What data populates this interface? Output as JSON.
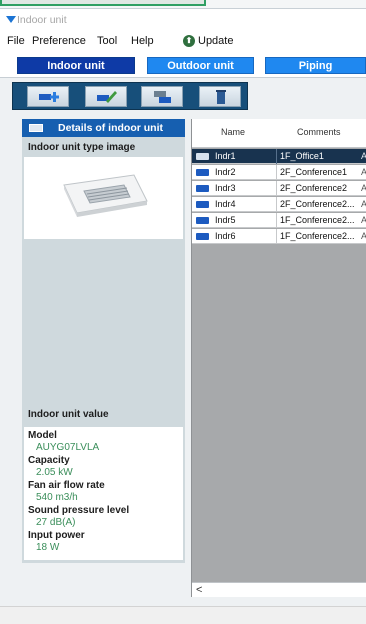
{
  "window": {
    "title": "Indoor unit"
  },
  "menu": {
    "file": "File",
    "preference": "Preference",
    "tool": "Tool",
    "help": "Help",
    "update": "Update"
  },
  "tabs": [
    {
      "label": "Indoor unit",
      "active": true
    },
    {
      "label": "Outdoor unit",
      "active": false
    },
    {
      "label": "Piping",
      "active": false
    }
  ],
  "toolbar": {
    "buttons": [
      "add-unit-icon",
      "edit-unit-icon",
      "copy-unit-icon",
      "delete-icon"
    ]
  },
  "details": {
    "header": "Details of indoor unit",
    "type_image_label": "Indoor unit type image",
    "value_label": "Indoor unit value",
    "fields": [
      {
        "label": "Model",
        "value": "AUYG07LVLA"
      },
      {
        "label": "Capacity",
        "value": "2.05 kW"
      },
      {
        "label": "Fan air flow rate",
        "value": "540 m3/h"
      },
      {
        "label": "Sound pressure level",
        "value": "27 dB(A)"
      },
      {
        "label": "Input power",
        "value": "18 W"
      }
    ]
  },
  "table": {
    "columns": [
      "Name",
      "Comments"
    ],
    "rows": [
      {
        "name": "Indr1",
        "comments": "1F_Office1",
        "trail": "A",
        "selected": true
      },
      {
        "name": "Indr2",
        "comments": "2F_Conference1",
        "trail": "A",
        "selected": false
      },
      {
        "name": "Indr3",
        "comments": "2F_Conference2",
        "trail": "A",
        "selected": false
      },
      {
        "name": "Indr4",
        "comments": "2F_Conference2...",
        "trail": "A",
        "selected": false
      },
      {
        "name": "Indr5",
        "comments": "1F_Conference2...",
        "trail": "A",
        "selected": false
      },
      {
        "name": "Indr6",
        "comments": "1F_Conference2...",
        "trail": "A",
        "selected": false
      }
    ],
    "scroll_left": "<"
  },
  "colors": {
    "tab_active": "#0e3aa6",
    "tab_inactive": "#1f88f0",
    "panel_header": "#165fb0",
    "value_text": "#3a8e5a",
    "selected_row": "#18334f"
  }
}
